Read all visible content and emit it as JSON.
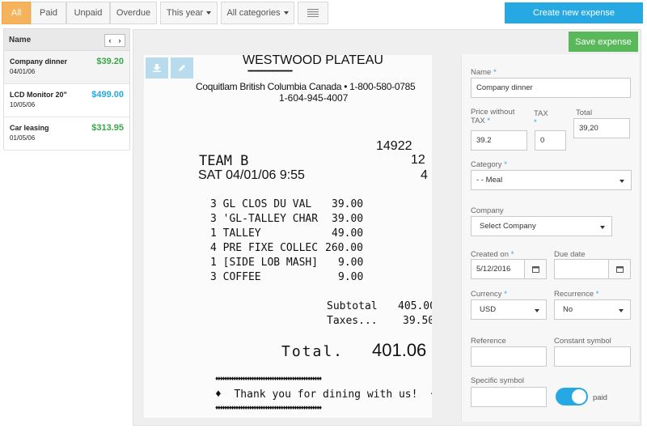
{
  "filters": {
    "status_tabs": [
      "All",
      "Paid",
      "Unpaid",
      "Overdue"
    ],
    "period": "This year",
    "category": "All categories",
    "create_label": "Create new expense"
  },
  "list": {
    "header": "Name",
    "items": [
      {
        "name": "Company dinner",
        "date": "04/01/06",
        "amount": "$39.20",
        "amount_color": "#3aa64a"
      },
      {
        "name": "LCD Monitor 20\"",
        "date": "10/05/06",
        "amount": "$499.00",
        "amount_color": "#26a8e3"
      },
      {
        "name": "Car leasing",
        "date": "01/05/06",
        "amount": "$313.95",
        "amount_color": "#3aa64a"
      }
    ]
  },
  "save_label": "Save expense",
  "receipt": {
    "header_name": "WESTWOOD PLATEAU",
    "dots": "••••••••••••••••••••••••••••••••••••••",
    "address": "Coquitlam British Columbia Canada • 1-800-580-0785",
    "phone": "1-604-945-4007",
    "check_no": "14922",
    "team": "TEAM B",
    "guests": "12",
    "datetime": "SAT 04/01/06 9:55",
    "table": "4",
    "items": [
      {
        "desc": "3 GL CLOS DU VAL",
        "price": "39.00"
      },
      {
        "desc": "3 'GL-TALLEY CHAR",
        "price": "39.00"
      },
      {
        "desc": "1 TALLEY",
        "price": "49.00"
      },
      {
        "desc": "4 PRE FIXE COLLEC",
        "price": "260.00"
      },
      {
        "desc": "1 [SIDE LOB MASH]",
        "price": "9.00"
      },
      {
        "desc": "3 COFFEE",
        "price": "9.00"
      }
    ],
    "subtotal_label": "Subtotal",
    "subtotal": "405.00",
    "taxes_label": "Taxes...",
    "taxes": "39.50",
    "total_label": "Total.",
    "total": "401.06",
    "stars": "♦♦♦♦♦♦♦♦♦♦♦♦♦♦♦♦♦♦♦♦♦♦♦♦♦♦♦♦♦♦♦♦♦♦♦♦♦♦♦♦♦♦♦♦♦♦♦",
    "thanks": "♦  Thank you for dining with us!  ♦"
  },
  "form": {
    "name_label": "Name",
    "name_value": "Company dinner",
    "price_label_1": "Price without",
    "price_label_2": "TAX",
    "price_value": "39.2",
    "tax_label": "TAX",
    "tax_value": "0",
    "total_label": "Total",
    "total_value": "39,20",
    "category_label": "Category",
    "category_value": "- - Meal",
    "company_label": "Company",
    "company_value": "Select Company",
    "created_label": "Created on",
    "created_value": "5/12/2016",
    "due_label": "Due date",
    "due_value": "",
    "currency_label": "Currency",
    "currency_value": "USD",
    "recurrence_label": "Recurrence",
    "recurrence_value": "No",
    "reference_label": "Reference",
    "constant_label": "Constant symbol",
    "specific_label": "Specific symbol",
    "paid_label": "paid",
    "paid_on": true
  }
}
